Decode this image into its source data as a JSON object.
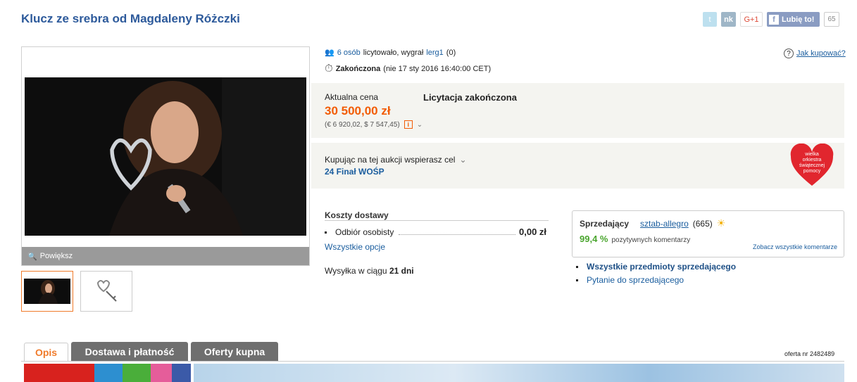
{
  "title": "Klucz ze srebra od Magdaleny Różczki",
  "social": {
    "twitter": "t",
    "nk": "nk",
    "gplus": "G+1",
    "fb_like": "Lubię to!",
    "fb_count": "65"
  },
  "gallery": {
    "zoom_label": "Powiększ"
  },
  "bids": {
    "count_link": "6 osób",
    "text": "licytowało, wygrał",
    "winner": "lerg1",
    "winner_score": "(0)"
  },
  "status": {
    "label": "Zakończona",
    "date": "(nie 17 sty 2016 16:40:00 CET)"
  },
  "help": {
    "label": "Jak kupować?"
  },
  "price": {
    "label": "Aktualna cena",
    "value": "30 500,00 zł",
    "conversions": "(€ 6 920,02, $ 7 547,45)",
    "auction_status": "Licytacja zakończona"
  },
  "cause": {
    "label": "Kupując na tej aukcji wspierasz cel",
    "name": "24 Finał WOŚP",
    "logo_text": "wielka orkiestra świątecznej pomocy"
  },
  "shipping": {
    "heading": "Koszty dostawy",
    "option": "Odbiór osobisty",
    "option_price": "0,00 zł",
    "all_options": "Wszystkie opcje",
    "dispatch_text": "Wysyłka w ciągu",
    "dispatch_days": "21 dni"
  },
  "seller": {
    "label": "Sprzedający",
    "name": "sztab-allegro",
    "rating_count": "(665)",
    "positive_pct": "99,4 %",
    "positive_text": "pozytywnych komentarzy",
    "all_comments": "Zobacz wszystkie komentarze",
    "all_items": "Wszystkie przedmioty sprzedającego",
    "ask": "Pytanie do sprzedającego"
  },
  "tabs": [
    "Opis",
    "Dostawa i płatność",
    "Oferty kupna"
  ],
  "offer": {
    "label": "oferta nr",
    "number": "2482489"
  },
  "colors": {
    "price": "#f25c05",
    "title": "#2d5a9b",
    "link": "#1a5d9e",
    "positive": "#4aa52e"
  }
}
